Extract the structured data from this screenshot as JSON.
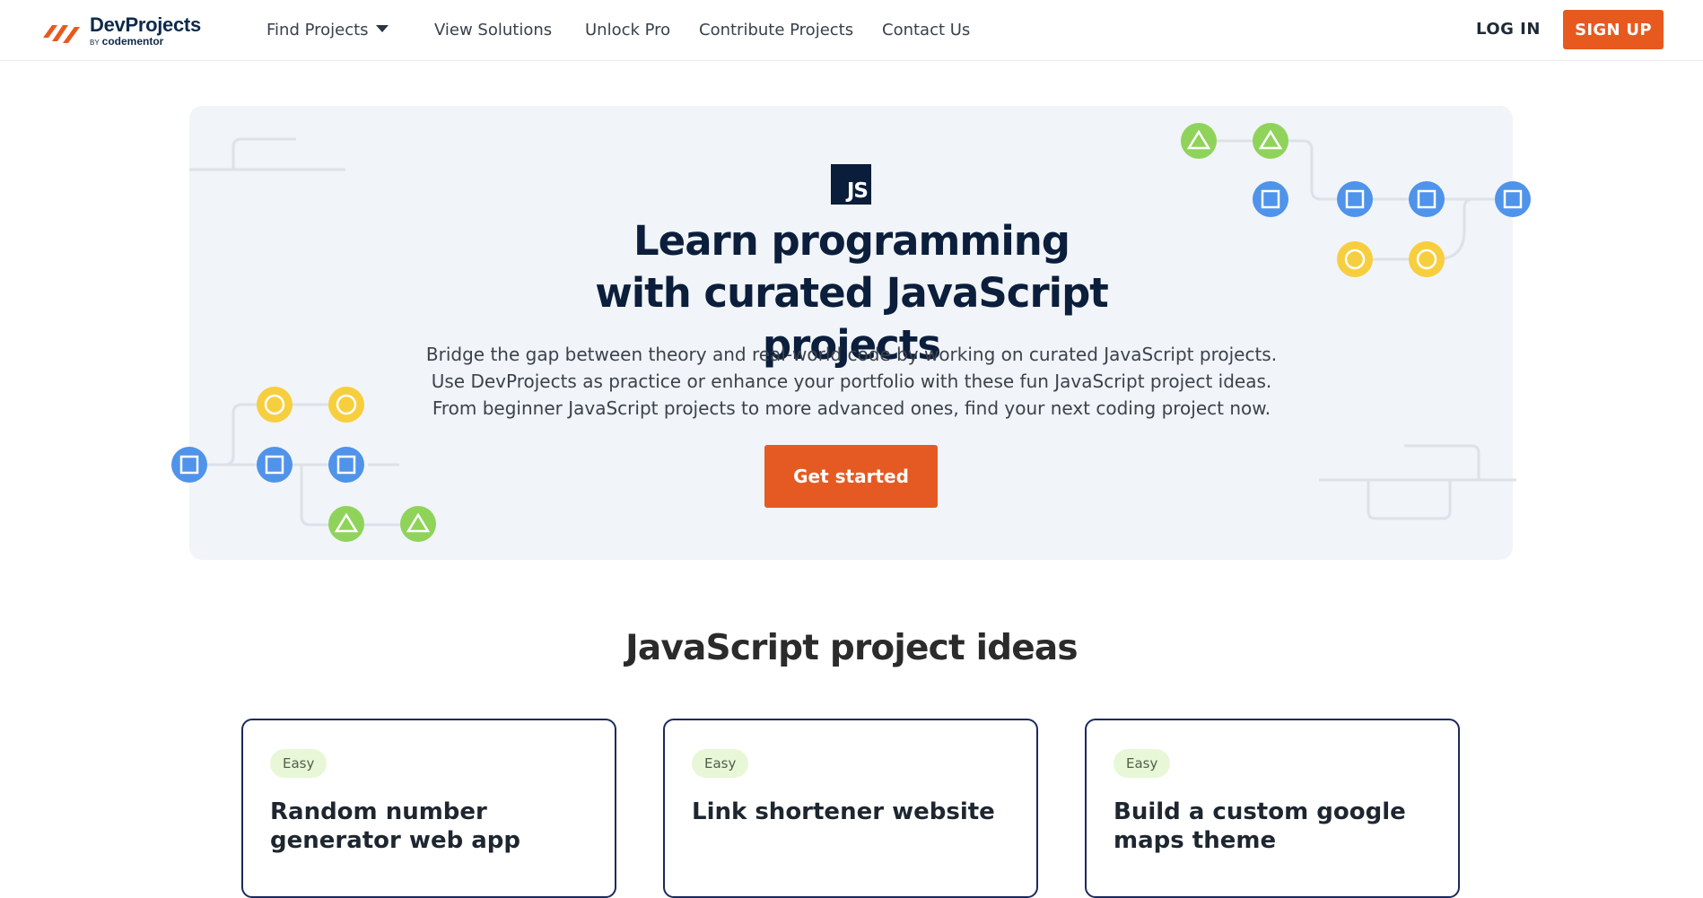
{
  "brand": {
    "name": "DevProjects",
    "by": "BY",
    "sub": "codementor",
    "accent": "#e8591f",
    "navy": "#0b1e3b"
  },
  "nav": {
    "links": [
      {
        "label": "Find Projects",
        "icon": "chevron-down-icon"
      },
      {
        "label": "View Solutions"
      },
      {
        "label": "Unlock Pro"
      },
      {
        "label": "Contribute Projects"
      },
      {
        "label": "Contact Us"
      }
    ],
    "login": "LOG IN",
    "signup": "SIGN UP"
  },
  "hero": {
    "badge": "JS",
    "title_line1": "Learn programming",
    "title_line2": "with curated JavaScript projects",
    "description": "Bridge the gap between theory and real-world code by working on curated JavaScript projects. Use DevProjects as practice or enhance your portfolio with these fun JavaScript project ideas. From beginner JavaScript projects to more advanced ones, find your next coding project now.",
    "cta": "Get started",
    "background": "#f1f4f8"
  },
  "ideas": {
    "title": "JavaScript project ideas",
    "cards": [
      {
        "difficulty": "Easy",
        "title": "Random number generator web app"
      },
      {
        "difficulty": "Easy",
        "title": "Link shortener website"
      },
      {
        "difficulty": "Easy",
        "title": "Build a custom google maps theme"
      }
    ]
  }
}
